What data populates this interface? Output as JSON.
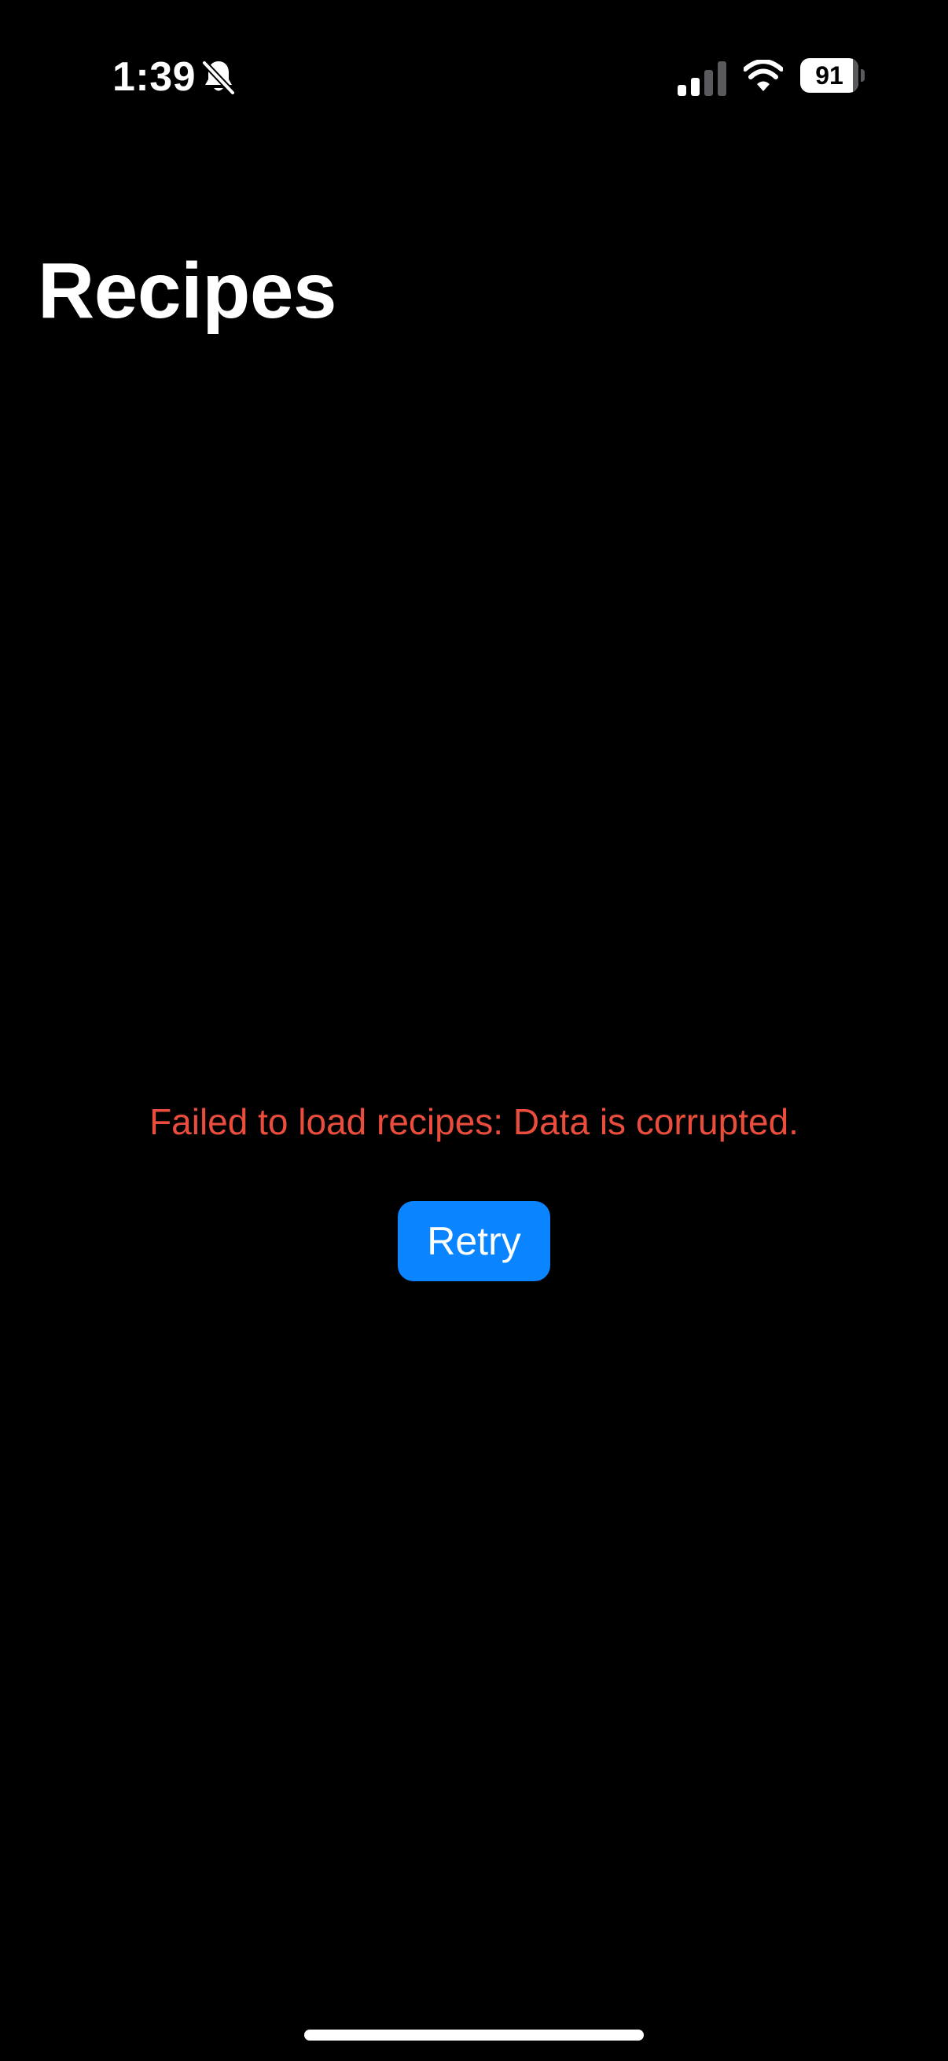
{
  "status_bar": {
    "time": "1:39",
    "battery_level": "91",
    "icons": [
      "bell-slash-icon",
      "cellular-signal-icon",
      "wifi-icon",
      "battery-icon"
    ]
  },
  "header": {
    "title": "Recipes"
  },
  "error": {
    "message": "Failed to load recipes: Data is corrupted.",
    "retry_label": "Retry"
  },
  "colors": {
    "background": "#000000",
    "error_text": "#eb4d3d",
    "accent": "#0a84ff",
    "text": "#ffffff"
  }
}
